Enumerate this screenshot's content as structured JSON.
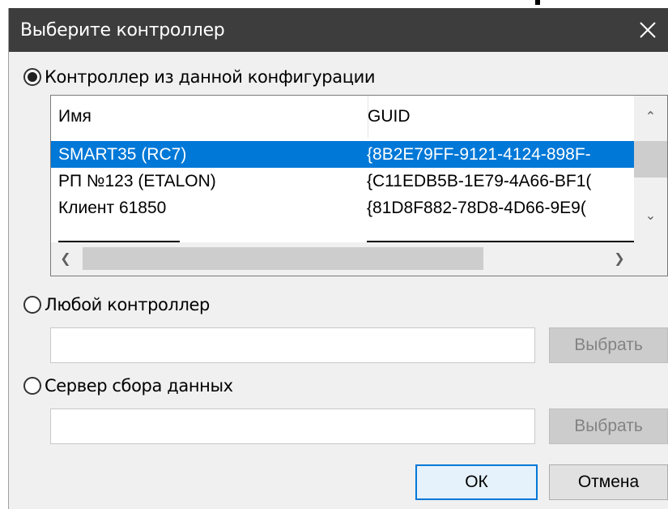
{
  "dialog": {
    "title": "Выберите контроллер",
    "close_icon": "close-icon"
  },
  "option_config": {
    "label": "Контроллер из данной конфигурации",
    "selected": true
  },
  "table": {
    "columns": [
      "Имя",
      "GUID"
    ],
    "rows": [
      {
        "name": "SMART35 (RC7)",
        "guid": "{8B2E79FF-9121-4124-898F-",
        "selected": true
      },
      {
        "name": "РП №123 (ETALON)",
        "guid": "{C11EDB5B-1E79-4A66-BF1(",
        "selected": false
      },
      {
        "name": "Клиент 61850",
        "guid": "{81D8F882-78D8-4D66-9E9(",
        "selected": false
      }
    ]
  },
  "option_any": {
    "label": "Любой контроллер",
    "selected": false,
    "field_value": "",
    "choose_label": "Выбрать"
  },
  "option_server": {
    "label": "Сервер сбора данных",
    "selected": false,
    "field_value": "",
    "choose_label": "Выбрать"
  },
  "footer": {
    "ok_label": "ОК",
    "cancel_label": "Отмена"
  },
  "colors": {
    "titlebar": "#3d3d3d",
    "selection": "#0078d7"
  }
}
